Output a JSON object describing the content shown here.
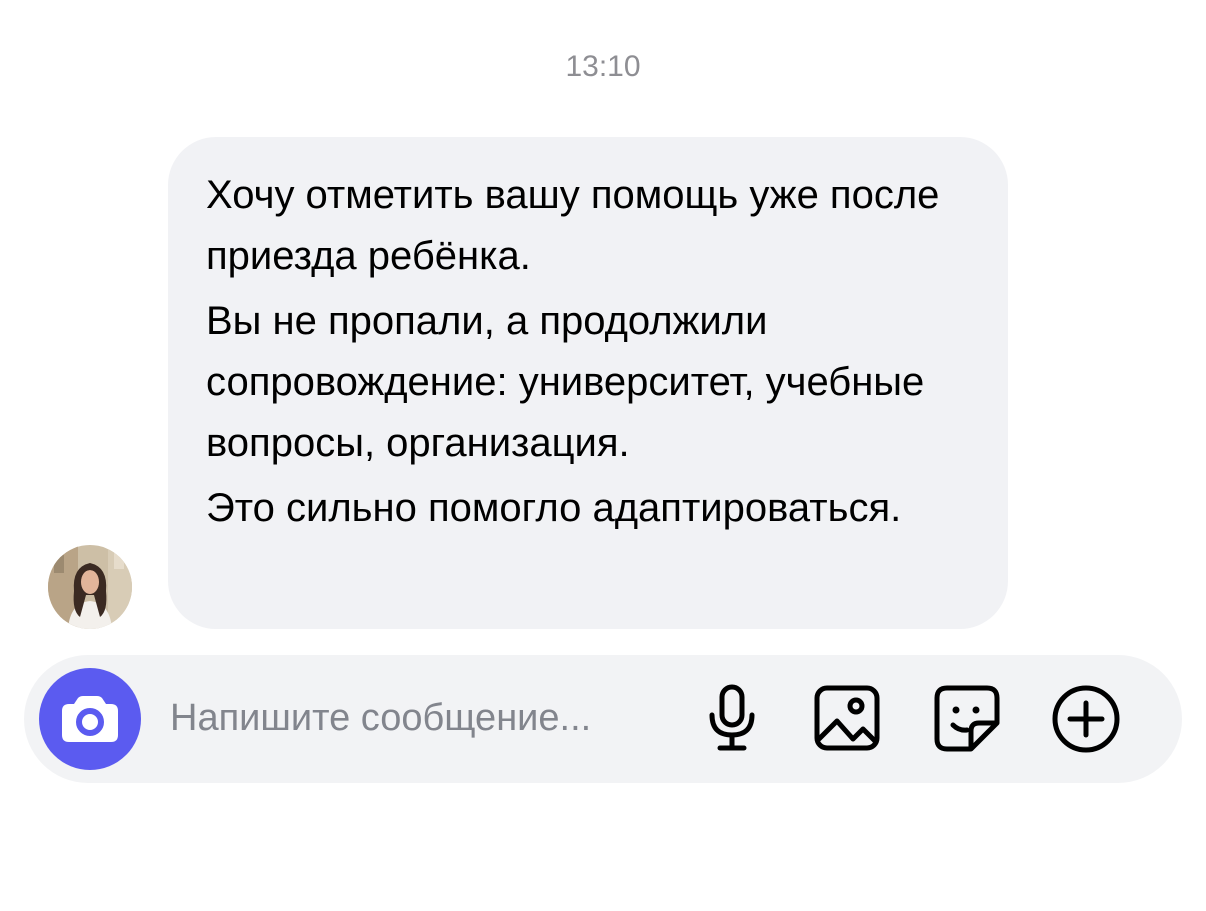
{
  "chat": {
    "timestamp": "13:10",
    "message": {
      "lines": [
        "Хочу отметить вашу помощь уже после приезда ребёнка.",
        "Вы не пропали, а продолжили сопровождение: университет, учебные вопросы, организация.",
        "Это сильно помогло адаптироваться."
      ]
    },
    "sender_avatar_icon": "user-avatar-photo"
  },
  "composer": {
    "placeholder": "Напишите сообщение...",
    "camera_icon": "camera-icon",
    "mic_icon": "microphone-icon",
    "image_icon": "image-icon",
    "sticker_icon": "sticker-icon",
    "add_icon": "plus-circle-icon"
  },
  "colors": {
    "accent": "#5b5bf0",
    "bubble_bg": "#f1f2f5",
    "composer_bg": "#f2f3f5",
    "timestamp": "#8e8e93",
    "placeholder": "#82858d",
    "icon": "#000000"
  }
}
